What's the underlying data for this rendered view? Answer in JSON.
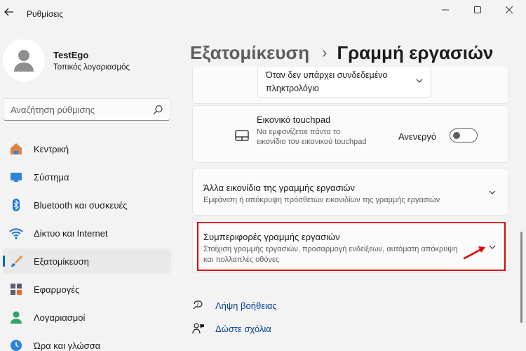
{
  "window": {
    "title": "Ρυθμίσεις"
  },
  "profile": {
    "name": "TestEgo",
    "type": "Τοπικός λογαριασμός"
  },
  "search": {
    "placeholder": "Αναζήτηση ρύθμισης"
  },
  "nav": {
    "items": [
      {
        "label": "Κεντρική",
        "icon": "home-icon"
      },
      {
        "label": "Σύστημα",
        "icon": "system-icon"
      },
      {
        "label": "Bluetooth και συσκευές",
        "icon": "bluetooth-icon"
      },
      {
        "label": "Δίκτυο και Internet",
        "icon": "wifi-icon"
      },
      {
        "label": "Εξατομίκευση",
        "icon": "brush-icon",
        "active": true
      },
      {
        "label": "Εφαρμογές",
        "icon": "apps-icon"
      },
      {
        "label": "Λογαριασμοί",
        "icon": "account-icon"
      },
      {
        "label": "Ώρα και γλώσσα",
        "icon": "time-language-icon"
      }
    ]
  },
  "breadcrumb": {
    "parent": "Εξατομίκευση",
    "separator": "›",
    "current": "Γραμμή εργασιών"
  },
  "keyboard_dropdown": {
    "value": "Όταν δεν υπάρχει συνδεδεμένο πληκτρολόγιο"
  },
  "touchpad": {
    "title": "Εικονικό touchpad",
    "description": "Να εμφανίζεται πάντα το εικονίδιο του εικονικού touchpad",
    "state_label": "Ανενεργό",
    "enabled": false
  },
  "other_icons": {
    "title": "Άλλα εικονίδια της γραμμής εργασιών",
    "description": "Εμφάνιση ή απόκρυψη πρόσθετων εικονιδίων της γραμμής εργασιών"
  },
  "behaviors": {
    "title": "Συμπεριφορές γραμμής εργασιών",
    "description": "Στοίχιση γραμμής εργασιών, προσαρμογή ενδείξεων, αυτόματη απόκρυψη και πολλαπλές οθόνες"
  },
  "help": {
    "get_help": "Λήψη βοήθειας",
    "feedback": "Δώστε σχόλια"
  },
  "colors": {
    "accent": "#0067c0",
    "highlight": "#e00000",
    "link": "#003e92"
  }
}
